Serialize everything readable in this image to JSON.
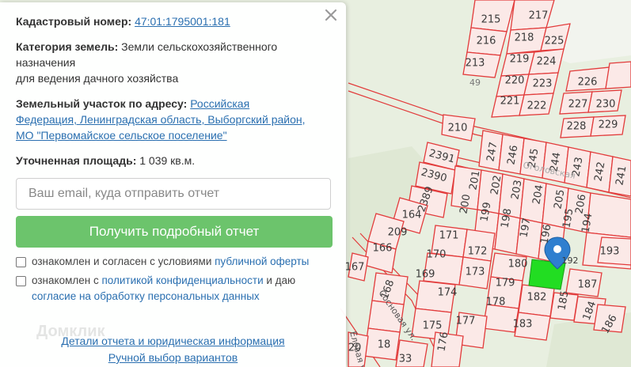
{
  "panel": {
    "cadastral_label": "Кадастровый номер:",
    "cadastral_number": "47:01:1795001:181",
    "category_label": "Категория земель:",
    "category_value_1": "Земли сельскохозяйственного",
    "category_value_2": "назначения",
    "category_value_3": "для ведения дачного хозяйства",
    "address_label": "Земельный участок по адресу:",
    "address_line_1": "Российская",
    "address_line_2": "Федерация, Ленинградская область, Выборгский район,",
    "address_line_3": "МО \"Первомайское сельское поселение\"",
    "area_label": "Уточненная площадь:",
    "area_value": "1 039 кв.м.",
    "email_placeholder": "Ваш email, куда отправить отчет",
    "submit_label": "Получить подробный отчет",
    "consent1_text": "ознакомлен и согласен с условиями ",
    "consent1_link": "публичной оферты",
    "consent2_text_a": "ознакомлен с ",
    "consent2_link_a": "политикой конфиденциальности",
    "consent2_text_b": " и даю",
    "consent2_link_b": "согласие на обработку персональных данных",
    "details_link": "Детали отчета и юридическая информация",
    "manual_link": "Ручной выбор вариантов",
    "watermark": "Домклик"
  },
  "colors": {
    "plot_stroke": "#e23b3b",
    "plot_fill": "#fbe9e7",
    "selected_plot": "#22dd22",
    "marker": "#2f7fcf",
    "button": "#6cc46c",
    "link": "#2a6fb0"
  },
  "map": {
    "plot_labels": [
      "215",
      "217",
      "216",
      "218",
      "225",
      "213",
      "219",
      "224",
      "220",
      "223",
      "226",
      "221",
      "222",
      "227",
      "230",
      "49",
      "228",
      "229",
      "210",
      "247",
      "246",
      "245",
      "244",
      "243",
      "242",
      "241",
      "2391",
      "2390",
      "201",
      "202",
      "203",
      "204",
      "205",
      "206",
      "2389",
      "200",
      "199",
      "198",
      "197",
      "196",
      "194",
      "195",
      "193",
      "164",
      "171",
      "172",
      "209",
      "166",
      "170",
      "173",
      "180",
      "187",
      "167",
      "169",
      "174",
      "179",
      "182",
      "185",
      "184",
      "168",
      "178",
      "175",
      "177",
      "183",
      "186",
      "18",
      "176",
      "20",
      "33",
      "192"
    ],
    "road_labels": [
      "Сосновая ул.",
      "Еловая ул.",
      "Оголовская"
    ]
  }
}
